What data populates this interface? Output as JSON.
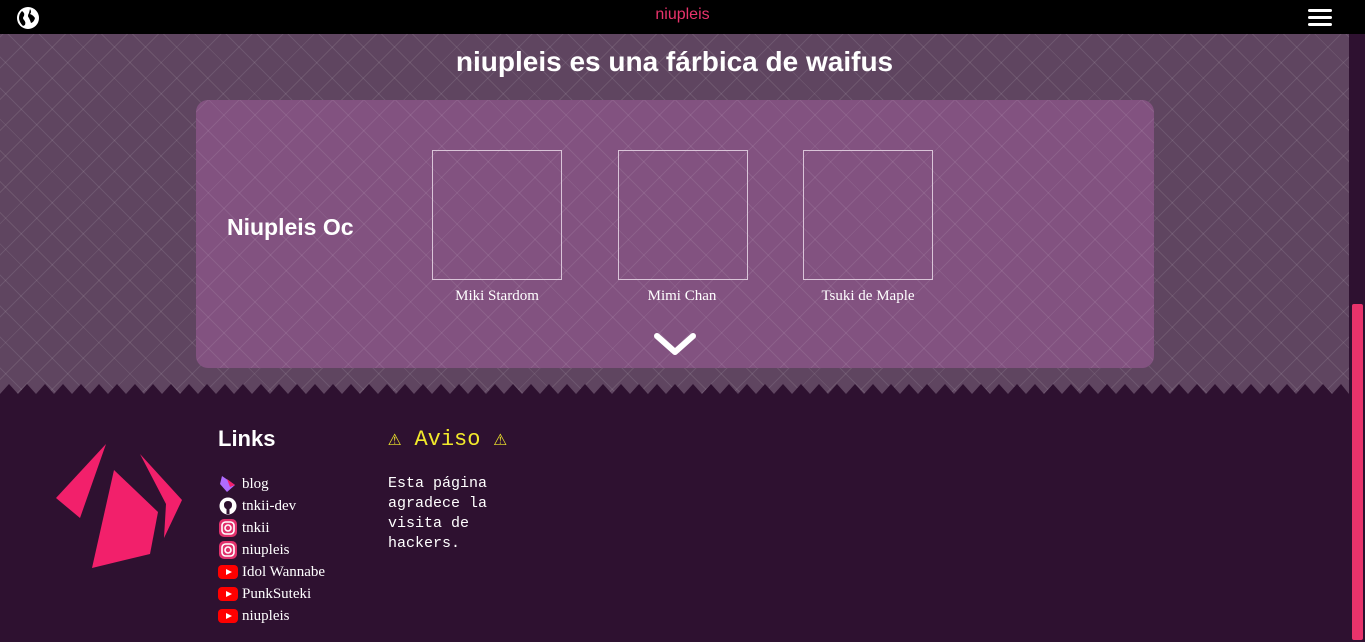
{
  "header": {
    "site_title": "niupleis"
  },
  "hero": {
    "headline": "niupleis es una fárbica de waifus"
  },
  "card": {
    "title": "Niupleis Oc",
    "items": [
      {
        "label": "Miki Stardom"
      },
      {
        "label": "Mimi Chan"
      },
      {
        "label": "Tsuki de Maple"
      }
    ]
  },
  "footer": {
    "links_title": "Links",
    "links": [
      {
        "icon": "blog-icon",
        "label": "blog"
      },
      {
        "icon": "github-icon",
        "label": "tnkii-dev"
      },
      {
        "icon": "instagram-icon",
        "label": "tnkii"
      },
      {
        "icon": "instagram-icon",
        "label": "niupleis"
      },
      {
        "icon": "youtube-icon",
        "label": "Idol Wannabe"
      },
      {
        "icon": "youtube-icon",
        "label": "PunkSuteki"
      },
      {
        "icon": "youtube-icon",
        "label": "niupleis"
      }
    ],
    "aviso_title": "⚠ Aviso ⚠",
    "aviso_text": "Esta página agradece la visita de hackers."
  },
  "colors": {
    "accent": "#e8336b",
    "footer_bg": "#2e1130",
    "card_bg": "#825280",
    "warning": "#f2e92b"
  }
}
